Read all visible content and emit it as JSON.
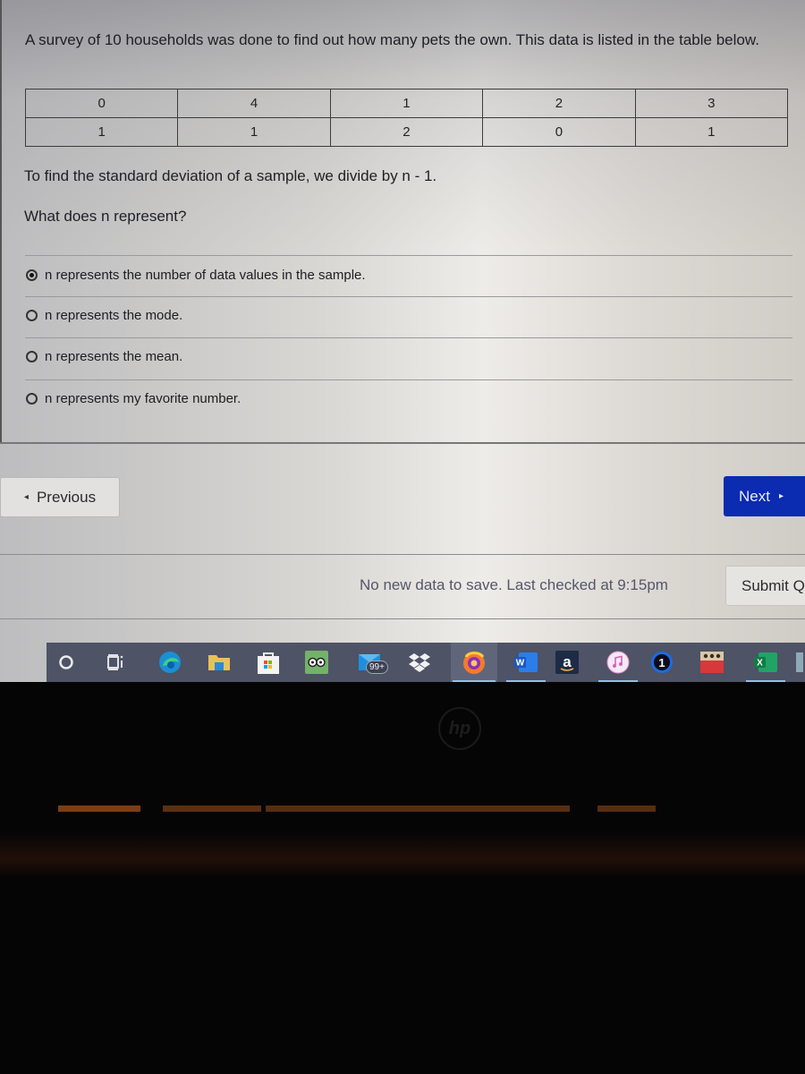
{
  "question": {
    "intro": "A survey of 10 households was done to find out how many pets the own. This data is listed in the table below.",
    "table": [
      [
        "0",
        "4",
        "1",
        "2",
        "3"
      ],
      [
        "1",
        "1",
        "2",
        "0",
        "1"
      ]
    ],
    "statement": "To find the standard deviation of a sample, we divide by n - 1.",
    "prompt": "What does n represent?",
    "options": [
      {
        "label": "n represents the number of data values in the sample.",
        "selected": true
      },
      {
        "label": "n represents the mode.",
        "selected": false
      },
      {
        "label": "n represents the mean.",
        "selected": false
      },
      {
        "label": "n represents my favorite number.",
        "selected": false
      }
    ]
  },
  "navigation": {
    "previous_label": "Previous",
    "previous_icon": "◂",
    "next_label": "Next",
    "next_icon": "▸"
  },
  "footer": {
    "save_status": "No new data to save. Last checked at 9:15pm",
    "submit_label": "Submit Q"
  },
  "taskbar": {
    "items": [
      {
        "name": "cortana-search",
        "icon": "circle"
      },
      {
        "name": "task-view",
        "icon": "task-view"
      },
      {
        "name": "microsoft-edge",
        "icon": "edge"
      },
      {
        "name": "file-explorer",
        "icon": "folder"
      },
      {
        "name": "microsoft-store",
        "icon": "store"
      },
      {
        "name": "tripadvisor",
        "icon": "owl"
      },
      {
        "name": "mail",
        "icon": "mail",
        "badge": "99+"
      },
      {
        "name": "dropbox",
        "icon": "dropbox"
      },
      {
        "name": "firefox",
        "icon": "firefox",
        "active": true
      },
      {
        "name": "word",
        "icon": "word",
        "letter": "W"
      },
      {
        "name": "amazon",
        "icon": "amazon",
        "letter": "a"
      },
      {
        "name": "itunes",
        "icon": "music"
      },
      {
        "name": "1password",
        "icon": "one",
        "letter": "1"
      },
      {
        "name": "game-app",
        "icon": "game"
      },
      {
        "name": "excel",
        "icon": "excel",
        "letter": "X"
      }
    ]
  },
  "colors": {
    "next_button": "#0b2bb0",
    "taskbar": "#4e5366",
    "taskbar_active_indicator": "#8fc0ea"
  },
  "device": {
    "logo_text": "hp"
  }
}
